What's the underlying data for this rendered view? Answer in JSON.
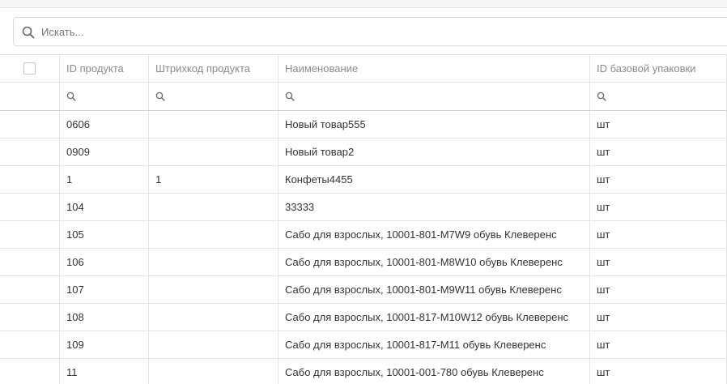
{
  "search": {
    "placeholder": "Искать..."
  },
  "columns": [
    "ID продукта",
    "Штрихкод продукта",
    "Наименование",
    "ID базовой упаковки"
  ],
  "rows": [
    {
      "id": "0606",
      "barcode": "",
      "name": "Новый товар555",
      "unit": "шт"
    },
    {
      "id": "0909",
      "barcode": "",
      "name": "Новый товар2",
      "unit": "шт"
    },
    {
      "id": "1",
      "barcode": "1",
      "name": "Конфеты4455",
      "unit": "шт"
    },
    {
      "id": "104",
      "barcode": "",
      "name": "33333",
      "unit": "шт"
    },
    {
      "id": "105",
      "barcode": "",
      "name": "Сабо для взрослых, 10001-801-M7W9 обувь Клеверенс",
      "unit": "шт"
    },
    {
      "id": "106",
      "barcode": "",
      "name": "Сабо для взрослых, 10001-801-M8W10 обувь Клеверенс",
      "unit": "шт"
    },
    {
      "id": "107",
      "barcode": "",
      "name": "Сабо для взрослых, 10001-801-M9W11 обувь Клеверенс",
      "unit": "шт"
    },
    {
      "id": "108",
      "barcode": "",
      "name": "Сабо для взрослых, 10001-817-M10W12 обувь Клеверенс",
      "unit": "шт"
    },
    {
      "id": "109",
      "barcode": "",
      "name": "Сабо для взрослых, 10001-817-M11 обувь Клеверенс",
      "unit": "шт"
    },
    {
      "id": "11",
      "barcode": "",
      "name": "Сабо для взрослых, 10001-001-780 обувь Клеверенс",
      "unit": "шт"
    }
  ],
  "icons": {
    "search": "search-icon",
    "filter": "filter-search-icon",
    "select_all": "checkbox"
  },
  "colors": {
    "header_text": "#8a8a8a",
    "border": "#e3e3e3",
    "text": "#333333"
  }
}
